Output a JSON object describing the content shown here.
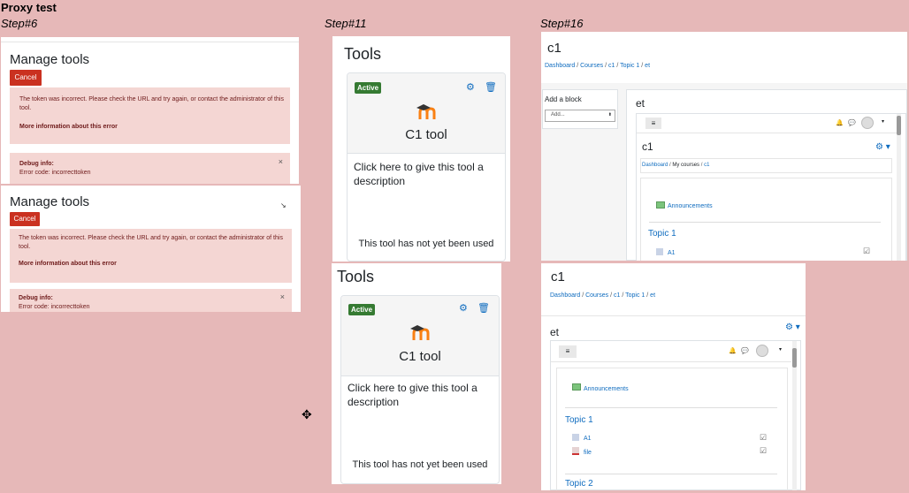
{
  "header": {
    "title": "Proxy test"
  },
  "steps": {
    "s6": "Step#6",
    "s11": "Step#11",
    "s16": "Step#16"
  },
  "manage_tools": {
    "title": "Manage tools",
    "cancel_label": "Cancel",
    "error_message": "The token was incorrect. Please check the URL and try again, or contact the administrator of this tool.",
    "more_info": "More information about this error",
    "debug_label": "Debug info:",
    "error_code": "Error code: incorrecttoken",
    "close_glyph": "×"
  },
  "tools": {
    "title": "Tools",
    "badge": "Active",
    "tool_name": "C1 tool",
    "description": "Click here to give this tool a description",
    "usage": "This tool has not yet been used"
  },
  "course": {
    "title": "c1",
    "breadcrumb": [
      "Dashboard",
      "Courses",
      "c1",
      "Topic 1",
      "et"
    ],
    "add_block": "Add a block",
    "add_select": "Add...",
    "activity": "et",
    "inner_title": "c1",
    "inner_breadcrumb": [
      "Dashboard",
      "My courses",
      "c1"
    ],
    "announcements": "Announcements",
    "topic1": "Topic 1",
    "topic2": "Topic 2",
    "a1": "A1",
    "file": "file",
    "menu_icon": "≡",
    "bell_icon": "🔔",
    "chat_icon": "💬",
    "gear_icon": "⚙"
  }
}
